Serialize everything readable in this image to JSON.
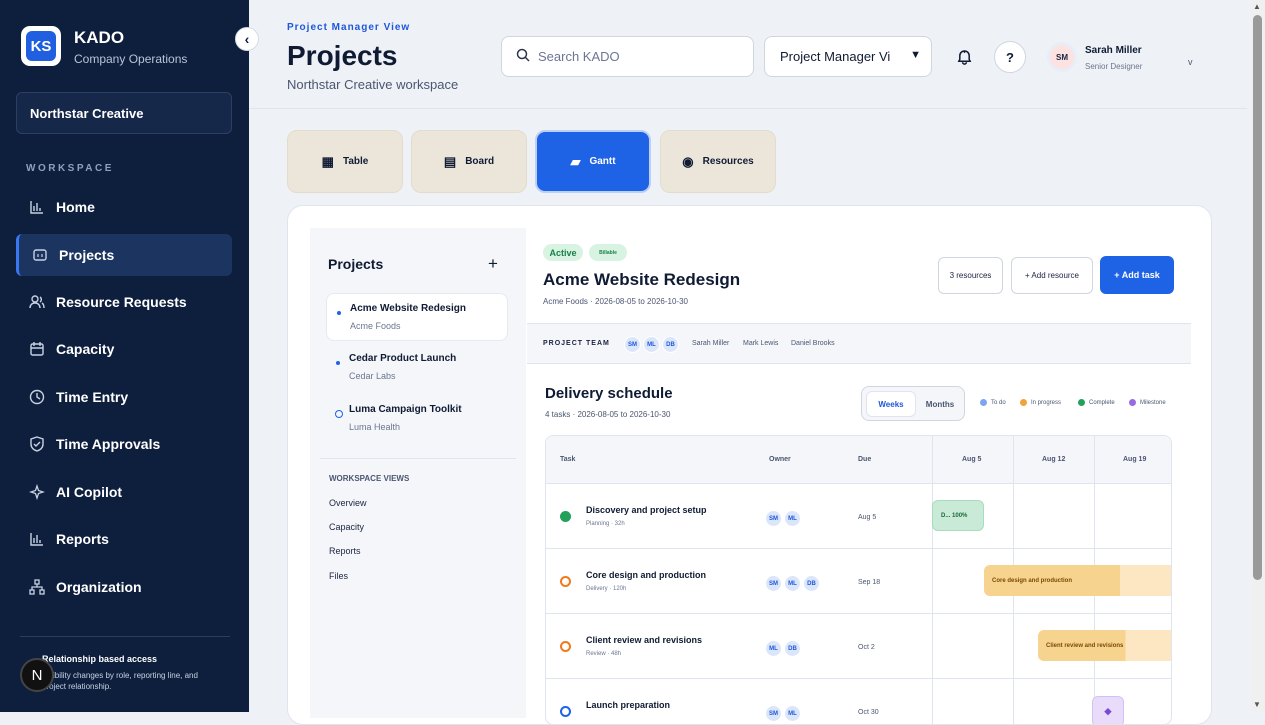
{
  "sidebar": {
    "logo_text": "KS",
    "brand": "KADO",
    "brand_sub": "Company Operations",
    "collapse_glyph": "‹",
    "org": "Northstar Creative",
    "section_label": "WORKSPACE",
    "items": [
      {
        "label": "Home",
        "icon": "bar-chart-icon",
        "glyph": "📊"
      },
      {
        "label": "Projects",
        "icon": "folder-icon",
        "glyph": "🗂"
      },
      {
        "label": "Resource Requests",
        "icon": "users-icon",
        "glyph": "👥"
      },
      {
        "label": "Capacity",
        "icon": "calendar-icon",
        "glyph": "📅"
      },
      {
        "label": "Time Entry",
        "icon": "clock-icon",
        "glyph": "◷"
      },
      {
        "label": "Time Approvals",
        "icon": "shield-check-icon",
        "glyph": "⛉"
      },
      {
        "label": "AI Copilot",
        "icon": "sparkle-icon",
        "glyph": "✧"
      },
      {
        "label": "Reports",
        "icon": "bar-chart-icon",
        "glyph": "📊"
      },
      {
        "label": "Organization",
        "icon": "org-chart-icon",
        "glyph": "☍"
      }
    ],
    "access_title": "Relationship based access",
    "access_text": "Visibility changes by role, reporting line, and project relationship.",
    "n_badge": "N"
  },
  "header": {
    "eyebrow": "Project Manager View",
    "title": "Projects",
    "subtitle": "Northstar Creative workspace",
    "search_placeholder": "Search KADO",
    "view_select": "Project Manager Vi",
    "user_initials": "SM",
    "user_name": "Sarah Miller",
    "user_role": "Senior Designer",
    "user_chevron": "v",
    "help": "?"
  },
  "view_tabs": [
    {
      "label": "Table",
      "icon": "table-icon",
      "glyph": "▦"
    },
    {
      "label": "Board",
      "icon": "board-icon",
      "glyph": "▤"
    },
    {
      "label": "Gantt",
      "icon": "gantt-icon",
      "glyph": "▰"
    },
    {
      "label": "Resources",
      "icon": "resources-icon",
      "glyph": "◉"
    }
  ],
  "project_list": {
    "title": "Projects",
    "add": "+",
    "projects": [
      {
        "name": "Acme Website Redesign",
        "client": "Acme Foods"
      },
      {
        "name": "Cedar Product Launch",
        "client": "Cedar Labs"
      },
      {
        "name": "Luma Campaign Toolkit",
        "client": "Luma Health"
      }
    ],
    "views_label": "WORKSPACE VIEWS",
    "views": [
      "Overview",
      "Capacity",
      "Reports",
      "Files"
    ]
  },
  "project": {
    "status": "Active",
    "billing": "Billable",
    "title": "Acme Website Redesign",
    "meta": "Acme Foods · 2026-08-05 to 2026-10-30",
    "resources_btn": "3 resources",
    "add_resource_btn": "+ Add resource",
    "add_task_btn": "+ Add task",
    "team_label": "PROJECT TEAM",
    "team_initials": [
      "SM",
      "ML",
      "DB"
    ],
    "team_names": [
      "Sarah Miller",
      "Mark Lewis",
      "Daniel Brooks"
    ]
  },
  "schedule": {
    "title": "Delivery schedule",
    "meta": "4 tasks · 2026-08-05 to 2026-10-30",
    "toggle_weeks": "Weeks",
    "toggle_months": "Months",
    "legend": [
      {
        "label": "To do",
        "color": "#7ea6ee"
      },
      {
        "label": "In progress",
        "color": "#f0a33a"
      },
      {
        "label": "Complete",
        "color": "#23a05a"
      },
      {
        "label": "Milestone",
        "color": "#9a6ae0"
      }
    ],
    "columns": {
      "task": "Task",
      "owner": "Owner",
      "due": "Due",
      "weeks": [
        "Aug 5",
        "Aug 12",
        "Aug 19"
      ]
    },
    "tasks": [
      {
        "name": "Discovery and project setup",
        "meta": "Planning · 32h",
        "owners": [
          "SM",
          "ML"
        ],
        "due": "Aug 5",
        "status_color": "#23a05a",
        "bar_label": "D...",
        "bar_pct": "100%"
      },
      {
        "name": "Core design and production",
        "meta": "Delivery · 120h",
        "owners": [
          "SM",
          "ML",
          "DB"
        ],
        "due": "Sep 18",
        "status_color": "#f07a1a",
        "bar_label": "Core design and production"
      },
      {
        "name": "Client review and revisions",
        "meta": "Review · 48h",
        "owners": [
          "ML",
          "DB"
        ],
        "due": "Oct 2",
        "status_color": "#f07a1a",
        "bar_label": "Client review and revisions"
      },
      {
        "name": "Launch preparation",
        "meta": "",
        "owners": [
          "SM",
          "ML"
        ],
        "due": "Oct 30",
        "status_color": "#1e62e6",
        "bar_label": ""
      }
    ]
  },
  "colors": {
    "accent": "#1e62e6",
    "sidebar": "#0e1f3d"
  }
}
